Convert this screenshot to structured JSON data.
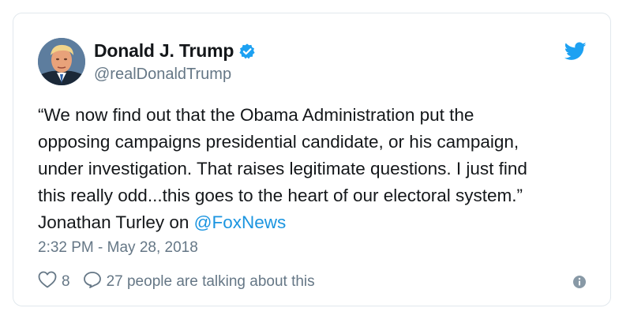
{
  "author": {
    "display_name": "Donald J. Trump",
    "handle": "@realDonaldTrump",
    "verified": true,
    "avatar_icon": "profile-photo"
  },
  "tweet": {
    "line1": "“We now find out that the Obama Administration put the",
    "line2": "opposing campaigns presidential candidate, or his campaign,",
    "line3": "under investigation. That raises legitimate questions. I just find",
    "line4": "this really odd...this goes to the heart of our electoral system.”",
    "line5_prefix": "Jonathan Turley on ",
    "mention": "@FoxNews"
  },
  "timestamp": "2:32 PM - May 28, 2018",
  "actions": {
    "likes_count": "8",
    "replies_text": "27 people are talking about this"
  },
  "icons": {
    "brand": "twitter-bird-icon",
    "verified": "verified-badge-icon",
    "like": "heart-icon",
    "reply": "comment-bubble-icon",
    "info": "info-icon"
  },
  "colors": {
    "brand_blue": "#1da1f2",
    "link_blue": "#1b95e0",
    "text_primary": "#14171a",
    "text_secondary": "#657786",
    "border": "#e1e8ed"
  }
}
